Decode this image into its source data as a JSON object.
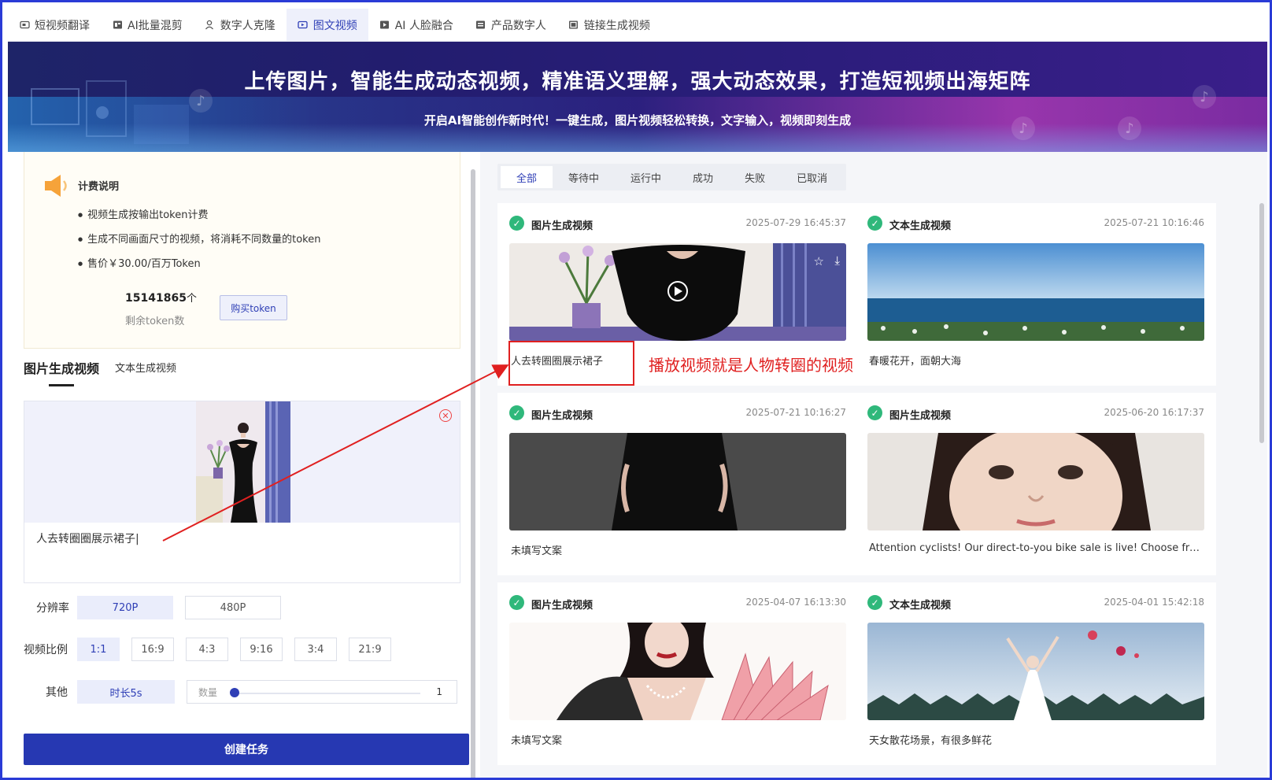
{
  "nav": {
    "tabs": [
      {
        "label": "短视频翻译",
        "icon": "video-translate-icon"
      },
      {
        "label": "AI批量混剪",
        "icon": "batch-edit-icon"
      },
      {
        "label": "数字人克隆",
        "icon": "clone-icon"
      },
      {
        "label": "图文视频",
        "icon": "image-video-icon",
        "active": true
      },
      {
        "label": "AI 人脸融合",
        "icon": "face-fusion-icon"
      },
      {
        "label": "产品数字人",
        "icon": "product-avatar-icon"
      },
      {
        "label": "链接生成视频",
        "icon": "link-video-icon"
      }
    ]
  },
  "banner": {
    "title": "上传图片，智能生成动态视频，精准语义理解，强大动态效果，打造短视频出海矩阵",
    "subtitle": "开启AI智能创作新时代！一键生成，图片视频轻松转换，文字输入，视频即刻生成"
  },
  "billing": {
    "title": "计费说明",
    "items": [
      "视频生成按输出token计费",
      "生成不同画面尺寸的视频，将消耗不同数量的token",
      "售价￥30.00/百万Token"
    ],
    "token_count": "15141865",
    "token_unit": "个",
    "token_label": "剩余token数",
    "buy_label": "购买token"
  },
  "mode_tabs": {
    "image": "图片生成视频",
    "text": "文本生成视频"
  },
  "upload": {
    "prompt": "人去转圈圈展示裙子|"
  },
  "options": {
    "resolution_label": "分辨率",
    "resolutions": [
      "720P",
      "480P"
    ],
    "ratio_label": "视频比例",
    "ratios": [
      "1:1",
      "16:9",
      "4:3",
      "9:16",
      "3:4",
      "21:9"
    ],
    "other_label": "其他",
    "duration": "时长5s",
    "quantity_label": "数量",
    "quantity_value": "1",
    "quantity_fraction": 0
  },
  "create_label": "创建任务",
  "status_tabs": [
    "全部",
    "等待中",
    "运行中",
    "成功",
    "失败",
    "已取消"
  ],
  "cards": [
    {
      "title": "图片生成视频",
      "time": "2025-07-29 16:45:37",
      "desc": "人去转圈圈展示裙子",
      "thumb": "woman-dress-flowers"
    },
    {
      "title": "文本生成视频",
      "time": "2025-07-21 10:16:46",
      "desc": "春暖花开，面朝大海",
      "thumb": "sea-flowers"
    },
    {
      "title": "图片生成视频",
      "time": "2025-07-21 10:16:27",
      "desc": "未填写文案",
      "thumb": "black-dress"
    },
    {
      "title": "图片生成视频",
      "time": "2025-06-20 16:17:37",
      "desc": "Attention cyclists!  Our direct-to-you bike sale is live! Choose from a wide selection",
      "thumb": "girl-face"
    },
    {
      "title": "图片生成视频",
      "time": "2025-04-07 16:13:30",
      "desc": "未填写文案",
      "thumb": "woman-money"
    },
    {
      "title": "文本生成视频",
      "time": "2025-04-01 15:42:18",
      "desc": "天女散花场景，有很多鲜花",
      "thumb": "girl-field"
    }
  ],
  "annotation": {
    "text": "播放视频就是人物转圈的视频",
    "color": "#e02020"
  },
  "colors": {
    "accent": "#2f3fb6",
    "button": "#2638b2",
    "success": "#2fb87b"
  }
}
